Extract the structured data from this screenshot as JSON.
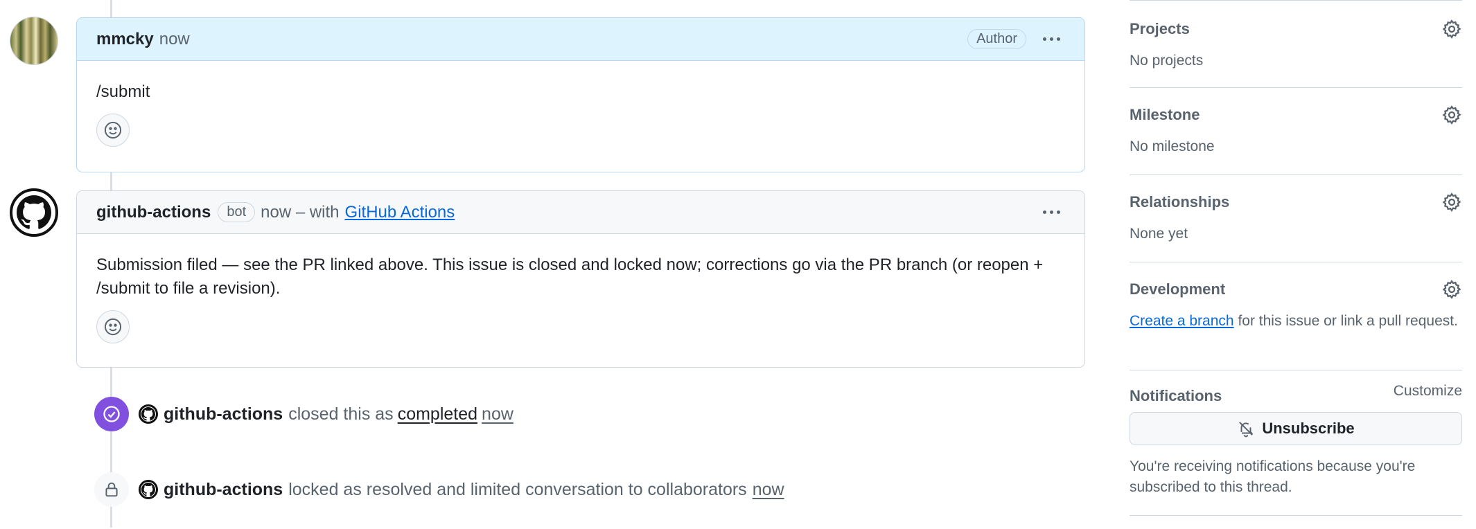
{
  "comments": [
    {
      "author": "mmcky",
      "time": "now",
      "badge": "Author",
      "body": "/submit"
    },
    {
      "author": "github-actions",
      "badge": "bot",
      "time": "now – with",
      "via": "GitHub Actions",
      "body": "Submission filed — see the PR linked above. This issue is closed and locked now; corrections go via the PR branch (or reopen + /submit to file a revision)."
    }
  ],
  "events": [
    {
      "actor": "github-actions",
      "text": "closed this as",
      "state": "completed",
      "time": "now"
    },
    {
      "actor": "github-actions",
      "text": "locked as resolved and limited conversation to collaborators",
      "time": "now"
    }
  ],
  "sidebar": {
    "projects": {
      "title": "Projects",
      "value": "No projects"
    },
    "milestone": {
      "title": "Milestone",
      "value": "No milestone"
    },
    "relationships": {
      "title": "Relationships",
      "value": "None yet"
    },
    "development": {
      "title": "Development",
      "link": "Create a branch",
      "text": "for this issue or link a pull request."
    },
    "notifications": {
      "title": "Notifications",
      "customize": "Customize",
      "button": "Unsubscribe",
      "text": "You're receiving notifications because you're subscribed to this thread."
    }
  },
  "colors": {
    "closed_purple": "#8250df",
    "link_blue": "#0969da",
    "author_header": "#ddf4ff"
  }
}
